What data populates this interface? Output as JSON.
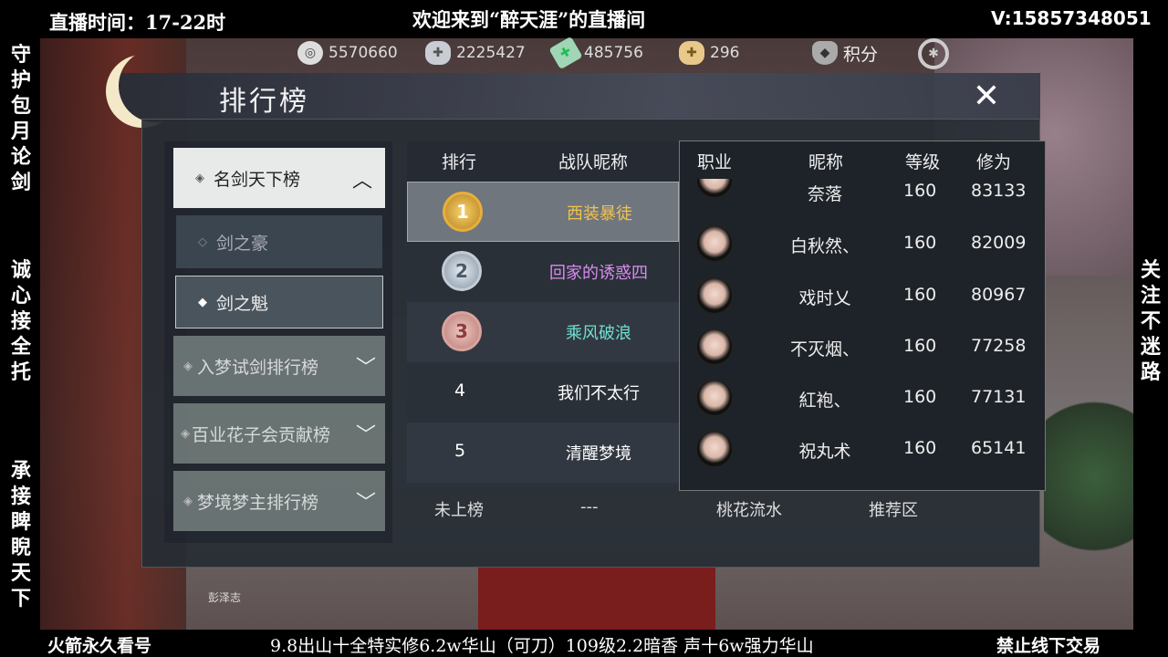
{
  "overlay": {
    "live_time": "直播时间：17-22时",
    "welcome": "欢迎来到“醉天涯”的直播间",
    "contact": "V:15857348051",
    "left_vertical_1": "守护包月论剑",
    "left_vertical_2": "诚心接全托",
    "left_vertical_3": "承接睥睨天下",
    "right_vertical": "关注不迷路",
    "bottom_left": "火箭永久看号",
    "bottom_middle": "9.8出山十全特实修6.2w华山（可刀）109级2.2暗香 声十6w强力华山",
    "bottom_right": "禁止线下交易"
  },
  "currency": {
    "c1": "5570660",
    "c2": "2225427",
    "c3": "485756",
    "c4": "296",
    "points_label": "积分"
  },
  "panel": {
    "title": "排行榜"
  },
  "menu": {
    "main": "名剑天下榜",
    "sub1": "剑之豪",
    "sub2": "剑之魁",
    "item3": "入梦试剑排行榜",
    "item4": "百业花子会贡献榜",
    "item5": "梦境梦主排行榜"
  },
  "ranking": {
    "headers": {
      "rank": "排行",
      "team": "战队昵称"
    },
    "rows": [
      {
        "rank": "1",
        "team": "西装暴徒",
        "color": "#f2c14e"
      },
      {
        "rank": "2",
        "team": "回家的诱惑四",
        "color": "#d98cf0"
      },
      {
        "rank": "3",
        "team": "乘风破浪",
        "color": "#6fe0d4"
      },
      {
        "rank": "4",
        "team": "我们不太行",
        "color": "#ffffff"
      },
      {
        "rank": "5",
        "team": "清醒梦境",
        "color": "#ffffff"
      }
    ],
    "unranked": {
      "rank": "未上榜",
      "team": "---",
      "server": "桃花流水",
      "region": "推荐区"
    }
  },
  "members": {
    "headers": {
      "job": "职业",
      "name": "昵称",
      "level": "等级",
      "power": "修为"
    },
    "rows": [
      {
        "name": "奈落",
        "level": "160",
        "power": "83133"
      },
      {
        "name": "白秋然、",
        "level": "160",
        "power": "82009"
      },
      {
        "name": "戏时乂",
        "level": "160",
        "power": "80967"
      },
      {
        "name": "不灭烟、",
        "level": "160",
        "power": "77258"
      },
      {
        "name": "紅袍、",
        "level": "160",
        "power": "77131"
      },
      {
        "name": "祝丸术",
        "level": "160",
        "power": "65141"
      }
    ]
  },
  "watermark": "彭泽志"
}
